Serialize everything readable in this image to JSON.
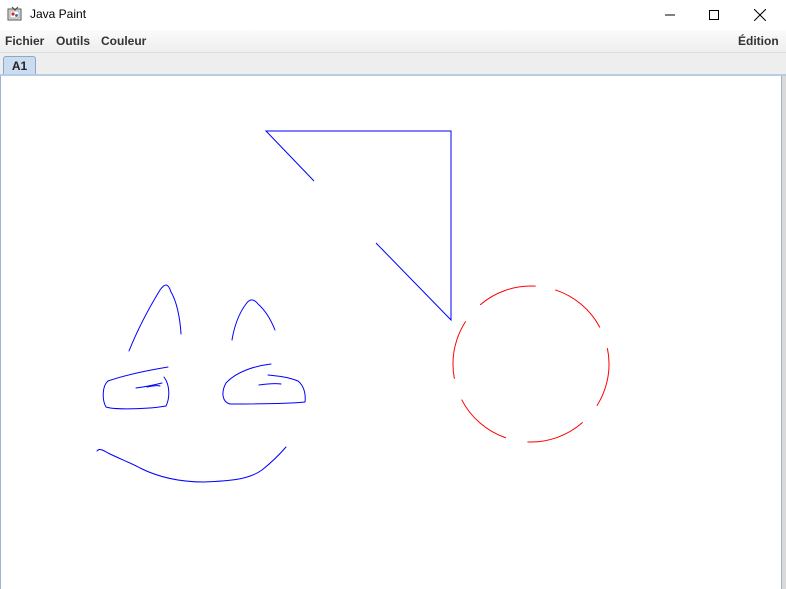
{
  "window": {
    "title": "Java Paint",
    "controls": [
      "minimize",
      "maximize",
      "close"
    ]
  },
  "menu": {
    "fichier": "Fichier",
    "outils": "Outils",
    "couleur": "Couleur",
    "edition": "Édition"
  },
  "tabs": [
    {
      "label": "A1",
      "selected": true
    }
  ],
  "colors": {
    "stroke_blue": "#0000ff",
    "stroke_red": "#ff0000",
    "tab_active": "#c9dcf0"
  },
  "canvas": {
    "shapes": [
      {
        "name": "triangle",
        "color": "blue"
      },
      {
        "name": "left-ear",
        "color": "blue"
      },
      {
        "name": "right-ear",
        "color": "blue"
      },
      {
        "name": "left-eye",
        "color": "blue"
      },
      {
        "name": "right-eye",
        "color": "blue"
      },
      {
        "name": "mouth",
        "color": "blue"
      },
      {
        "name": "dashed-circle",
        "color": "red"
      }
    ]
  }
}
